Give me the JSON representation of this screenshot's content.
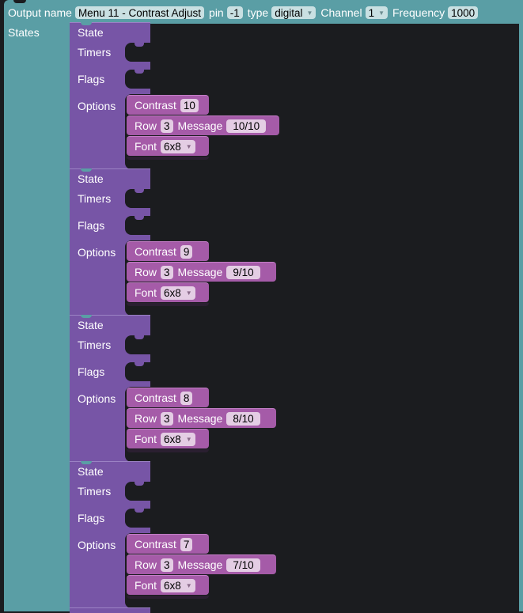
{
  "output": {
    "name_label": "Output name",
    "name_value": "Menu 11 - Contrast Adjust",
    "pin_label": "pin",
    "pin_value": "-1",
    "type_label": "type",
    "type_value": "digital",
    "channel_label": "Channel",
    "channel_value": "1",
    "frequency_label": "Frequency",
    "frequency_value": "1000",
    "states_label": "States"
  },
  "labels": {
    "state": "State",
    "timers": "Timers",
    "flags": "Flags",
    "options": "Options",
    "contrast": "Contrast",
    "row": "Row",
    "message": "Message",
    "font": "Font"
  },
  "states": [
    {
      "contrast": "10",
      "row": "3",
      "message": "10/10",
      "font": "6x8"
    },
    {
      "contrast": "9",
      "row": "3",
      "message": "9/10",
      "font": "6x8"
    },
    {
      "contrast": "8",
      "row": "3",
      "message": "8/10",
      "font": "6x8"
    },
    {
      "contrast": "7",
      "row": "3",
      "message": "7/10",
      "font": "6x8"
    }
  ],
  "icons": {
    "dropdown": "chevron-down-icon"
  },
  "colors": {
    "output_block": "#5a9ea5",
    "state_block": "#7755a6",
    "option_block": "#a55ba8",
    "workspace": "#1b1c1f"
  }
}
